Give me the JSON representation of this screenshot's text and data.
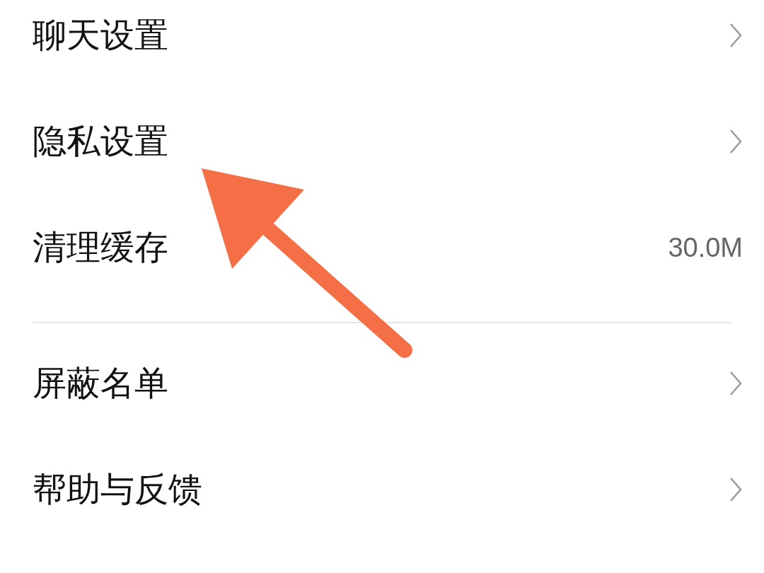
{
  "groups": [
    {
      "items": [
        {
          "kind": "link",
          "label": "聊天设置"
        },
        {
          "kind": "link",
          "label": "隐私设置"
        },
        {
          "kind": "value",
          "label": "清理缓存",
          "value": "30.0M"
        }
      ]
    },
    {
      "items": [
        {
          "kind": "link",
          "label": "屏蔽名单"
        },
        {
          "kind": "link",
          "label": "帮助与反馈"
        }
      ]
    }
  ]
}
